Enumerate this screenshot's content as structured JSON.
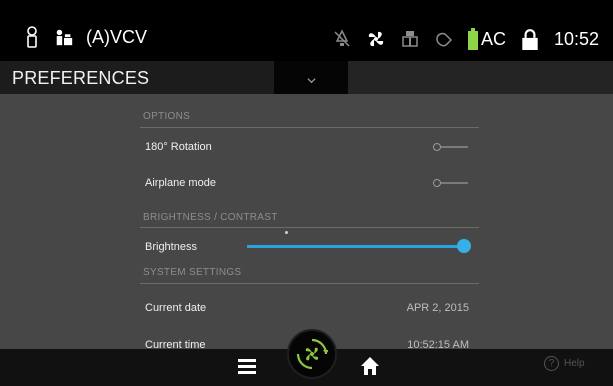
{
  "status_bar": {
    "mode": "(A)VCV",
    "battery_label": "AC",
    "time": "10:52",
    "icons": [
      "patient-icon",
      "adult-icon",
      "alarm-off-icon",
      "fan-icon",
      "device-icon",
      "connection-icon",
      "battery-icon",
      "lock-icon"
    ]
  },
  "header": {
    "title": "PREFERENCES"
  },
  "options": {
    "heading": "OPTIONS",
    "rotation_label": "180° Rotation",
    "airplane_label": "Airplane mode"
  },
  "brightness": {
    "heading": "BRIGHTNESS / CONTRAST",
    "label": "Brightness",
    "level": 1.0
  },
  "system": {
    "heading": "SYSTEM SETTINGS",
    "date_label": "Current date",
    "date_value": "APR 2, 2015",
    "time_label": "Current time",
    "time_value": "10:52:15 AM"
  },
  "nav": {
    "help_label": "Help"
  },
  "colors": {
    "accent": "#2aa3df",
    "battery": "#8fd34a",
    "fan_ring": "#8dc63f"
  }
}
